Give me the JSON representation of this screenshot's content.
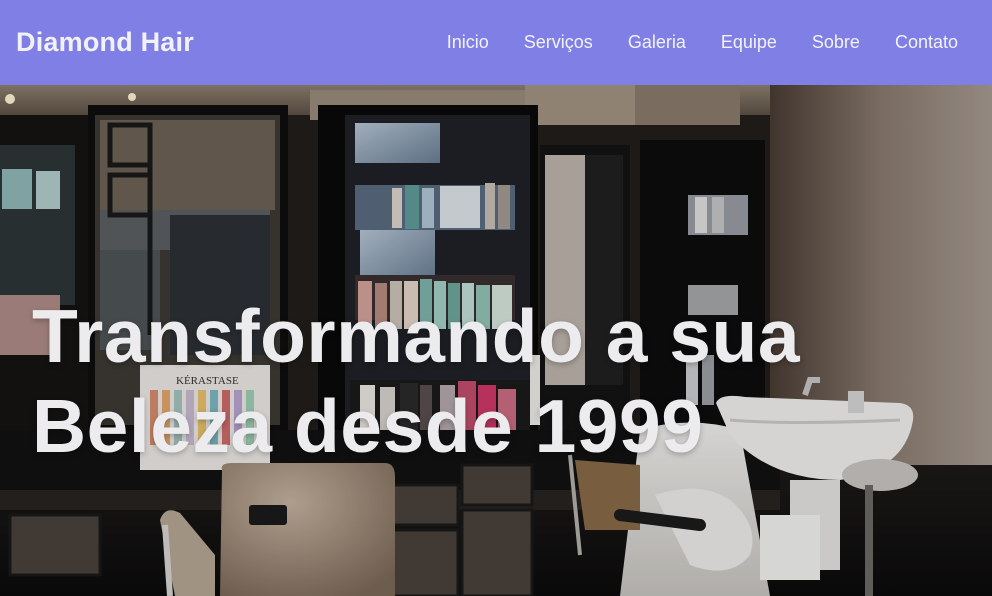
{
  "header": {
    "brand": "Diamond Hair",
    "nav": [
      {
        "label": "Inicio"
      },
      {
        "label": "Serviços"
      },
      {
        "label": "Galeria"
      },
      {
        "label": "Equipe"
      },
      {
        "label": "Sobre"
      },
      {
        "label": "Contato"
      }
    ]
  },
  "hero": {
    "title": "Transformando a sua Beleza desde 1999",
    "image_alt": "Salon interior with mirrors, product shelves, styling chair and wash basin",
    "product_sign": "KÉRASTASE"
  },
  "colors": {
    "navbar": "#7f7fe6",
    "nav_text": "#f3f3f8",
    "hero_text": "#ecebee"
  }
}
